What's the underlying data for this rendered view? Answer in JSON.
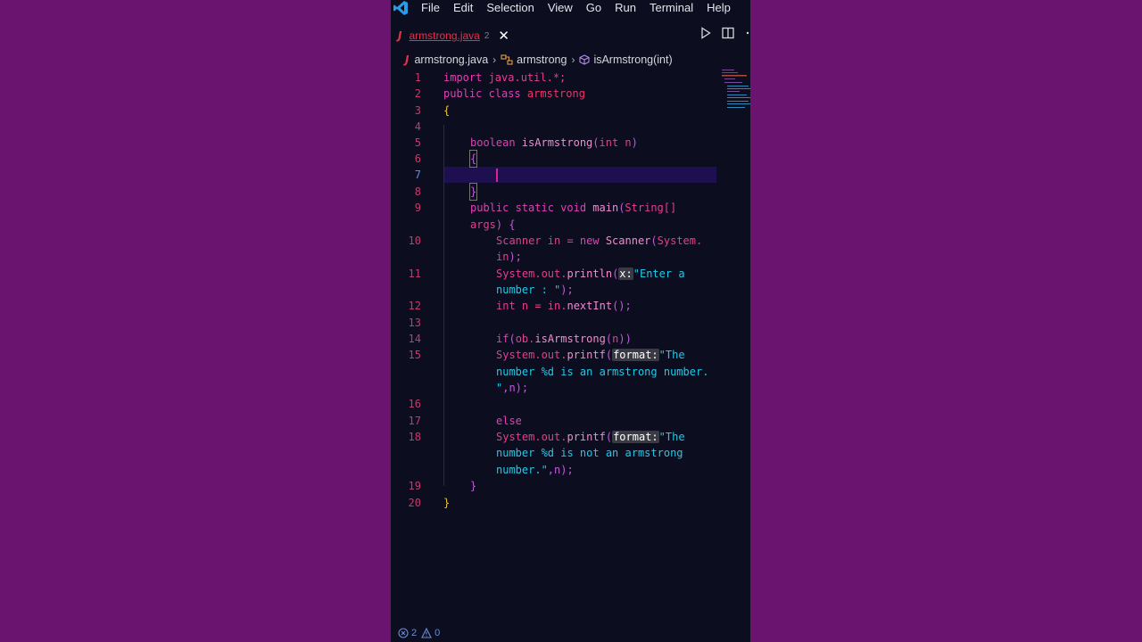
{
  "menu": [
    "File",
    "Edit",
    "Selection",
    "View",
    "Go",
    "Run",
    "Terminal",
    "Help"
  ],
  "tab": {
    "icon": "J",
    "label": "armstrong.java",
    "dirty": "2"
  },
  "breadcrumb": {
    "file": "armstrong.java",
    "cls": "armstrong",
    "method": "isArmstrong(int)"
  },
  "status": {
    "errors": "2",
    "warnings": "0"
  },
  "code": {
    "ln1": "1",
    "l1a": "import ",
    "l1b": "java.util.*;",
    "ln2": "2",
    "l2a": "public class ",
    "l2b": "armstrong",
    "ln3": "3",
    "l3a": "{",
    "ln4": "4",
    "ln5": "5",
    "l5a": "boolean ",
    "l5b": "isArmstrong",
    "l5c": "(",
    "l5d": "int n",
    "l5e": ")",
    "ln6": "6",
    "l6a": "{",
    "ln7": "7",
    "ln8": "8",
    "l8a": "}",
    "ln9": "9",
    "l9a": "public static void ",
    "l9b": "main",
    "l9c": "(",
    "l9d": "String[]",
    "l9e": "args",
    "l9f": ") {",
    "ln10": "10",
    "l10a": "Scanner in = ",
    "l10b": "new ",
    "l10c": "Scanner",
    "l10d": "(",
    "l10e": "System.",
    "l10f": "in",
    "l10g": ");",
    "ln11": "11",
    "l11a": "System.out.",
    "l11b": "println",
    "l11c": "(",
    "l11d": "x:",
    "l11e": "\"Enter a",
    "l11f": "number : \"",
    "l11g": ");",
    "ln12": "12",
    "l12a": "int n = in.",
    "l12b": "nextInt",
    "l12c": "();",
    "ln13": "13",
    "ln14": "14",
    "l14a": "if",
    "l14b": "(",
    "l14c": "ob.",
    "l14d": "isArmstrong",
    "l14e": "(",
    "l14f": "n",
    "l14g": ")",
    "l14h": ")",
    "ln15": "15",
    "l15a": "System.out.",
    "l15b": "printf",
    "l15c": "(",
    "l15d": "format:",
    "l15e": "\"The",
    "l15f": "number %d is an armstrong number.",
    "l15g": "\"",
    "l15h": ",n);",
    "ln16": "16",
    "ln17": "17",
    "l17a": "else",
    "ln18": "18",
    "l18a": "System.out.",
    "l18b": "printf",
    "l18c": "(",
    "l18d": "format:",
    "l18e": "\"The",
    "l18f": "number %d is not an armstrong",
    "l18g": "number.\"",
    "l18h": ",n);",
    "ln19": "19",
    "l19a": "}",
    "ln20": "20",
    "l20a": "}"
  }
}
